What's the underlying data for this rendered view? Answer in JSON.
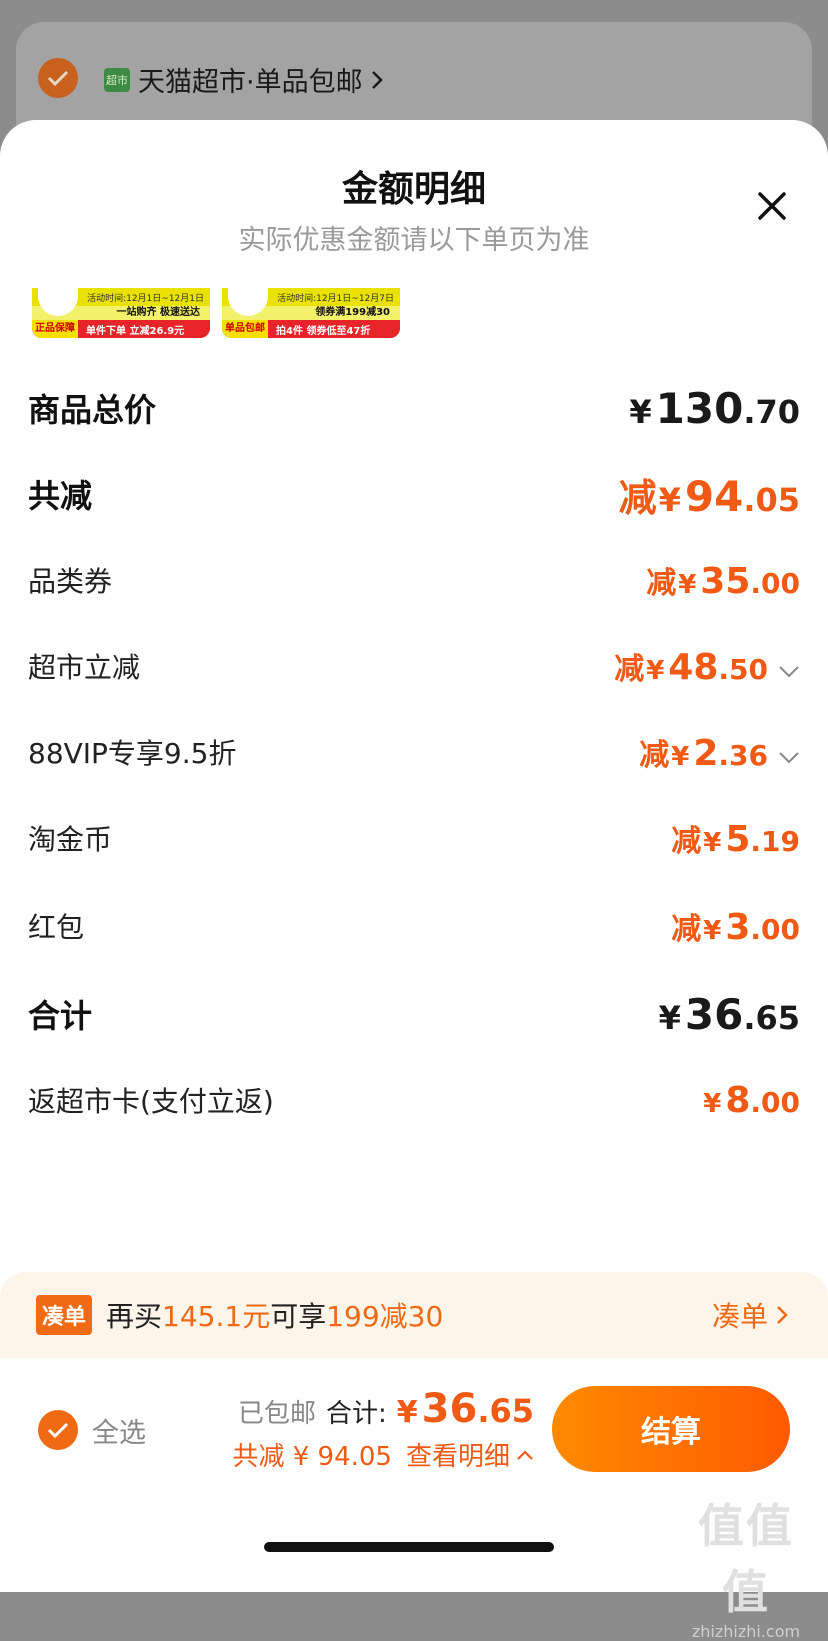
{
  "background": {
    "store_name": "天猫超市·单品包邮",
    "store_logo_text": "超市"
  },
  "sheet": {
    "title": "金额明细",
    "subtitle": "实际优惠金额请以下单页为准"
  },
  "thumbnails": [
    {
      "line1": "活动时间:12月1日~12月1日",
      "line2": "一站购齐 极速送达",
      "badge": "正品保障",
      "promo": "单件下单 立减26.9元"
    },
    {
      "line1": "活动时间:12月1日~12月7日",
      "line2": "领券满199减30",
      "badge": "单品包邮",
      "promo": "拍4件 领券低至47折"
    }
  ],
  "rows": [
    {
      "label": "商品总价",
      "prefix": "",
      "currency": "¥",
      "int": "130",
      "dec": ".70"
    },
    {
      "label": "共减",
      "prefix": "减",
      "currency": "¥",
      "int": "94",
      "dec": ".05"
    },
    {
      "label": "品类券",
      "prefix": "减",
      "currency": "¥",
      "int": "35",
      "dec": ".00"
    },
    {
      "label": "超市立减",
      "prefix": "减",
      "currency": "¥",
      "int": "48",
      "dec": ".50"
    },
    {
      "label": "88VIP专享9.5折",
      "prefix": "减",
      "currency": "¥",
      "int": "2",
      "dec": ".36"
    },
    {
      "label": "淘金币",
      "prefix": "减",
      "currency": "¥",
      "int": "5",
      "dec": ".19"
    },
    {
      "label": "红包",
      "prefix": "减",
      "currency": "¥",
      "int": "3",
      "dec": ".00"
    },
    {
      "label": "合计",
      "prefix": "",
      "currency": "¥",
      "int": "36",
      "dec": ".65"
    },
    {
      "label": "返超市卡(支付立返)",
      "prefix": "",
      "currency": "¥",
      "int": "8",
      "dec": ".00"
    }
  ],
  "promo_bar": {
    "tag": "凑单",
    "text_a": "再买",
    "amount": "145.1元",
    "text_b": "可享",
    "offer": "199减30",
    "link": "凑单"
  },
  "footer": {
    "select_all": "全选",
    "free_shipping": "已包邮",
    "total_label": "合计:",
    "total_currency": "¥",
    "total_int": "36",
    "total_dec": ".65",
    "discount": "共减 ¥ 94.05",
    "view_detail": "查看明细",
    "checkout": "结算"
  },
  "watermark": {
    "big": "值值值",
    "small": "zhizhizhi.com"
  },
  "colors": {
    "accent": "#f05a14",
    "checkout_start": "#ff8a00",
    "checkout_end": "#ff5a00"
  }
}
